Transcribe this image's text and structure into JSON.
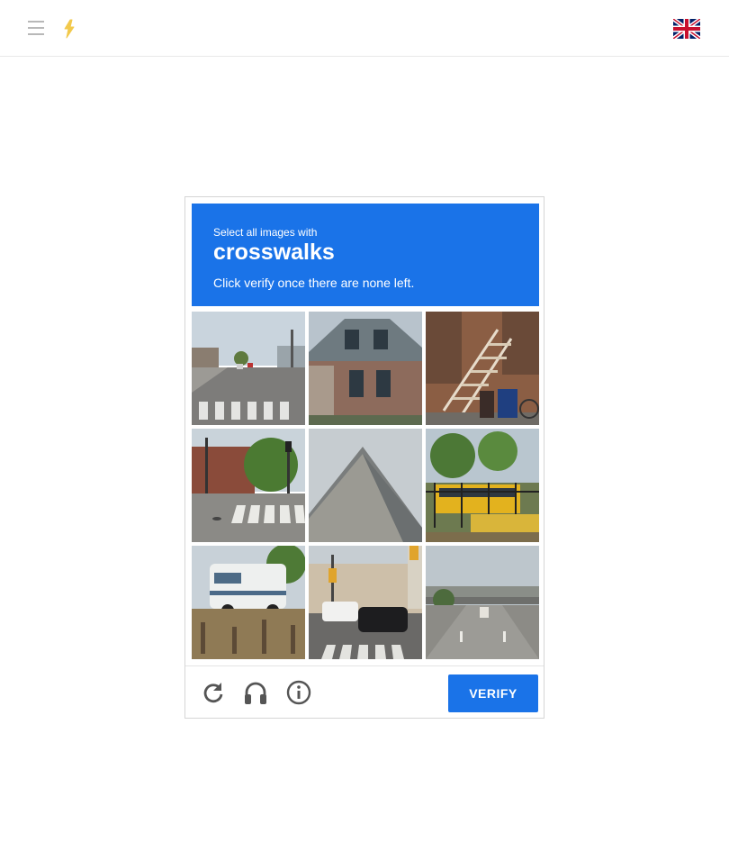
{
  "header": {
    "menu_icon": "hamburger-menu-icon",
    "logo_icon": "lightning-logo-icon",
    "language_icon": "uk-flag-icon"
  },
  "captcha": {
    "instruction_line": "Select all images with",
    "target": "crosswalks",
    "hint": "Click verify once there are none left.",
    "tiles": [
      {
        "id": 1,
        "scene": "street-with-crosswalk"
      },
      {
        "id": 2,
        "scene": "brick-house"
      },
      {
        "id": 3,
        "scene": "stairs-and-trash-bins"
      },
      {
        "id": 4,
        "scene": "crosswalk-at-intersection"
      },
      {
        "id": 5,
        "scene": "house-roof"
      },
      {
        "id": 6,
        "scene": "school-bus"
      },
      {
        "id": 7,
        "scene": "motorhome"
      },
      {
        "id": 8,
        "scene": "cars-at-crosswalk"
      },
      {
        "id": 9,
        "scene": "highway-overpass"
      }
    ],
    "footer": {
      "reload_icon": "reload-icon",
      "audio_icon": "headphones-icon",
      "info_icon": "info-icon",
      "verify_label": "VERIFY"
    },
    "colors": {
      "accent": "#1a73e8"
    }
  }
}
